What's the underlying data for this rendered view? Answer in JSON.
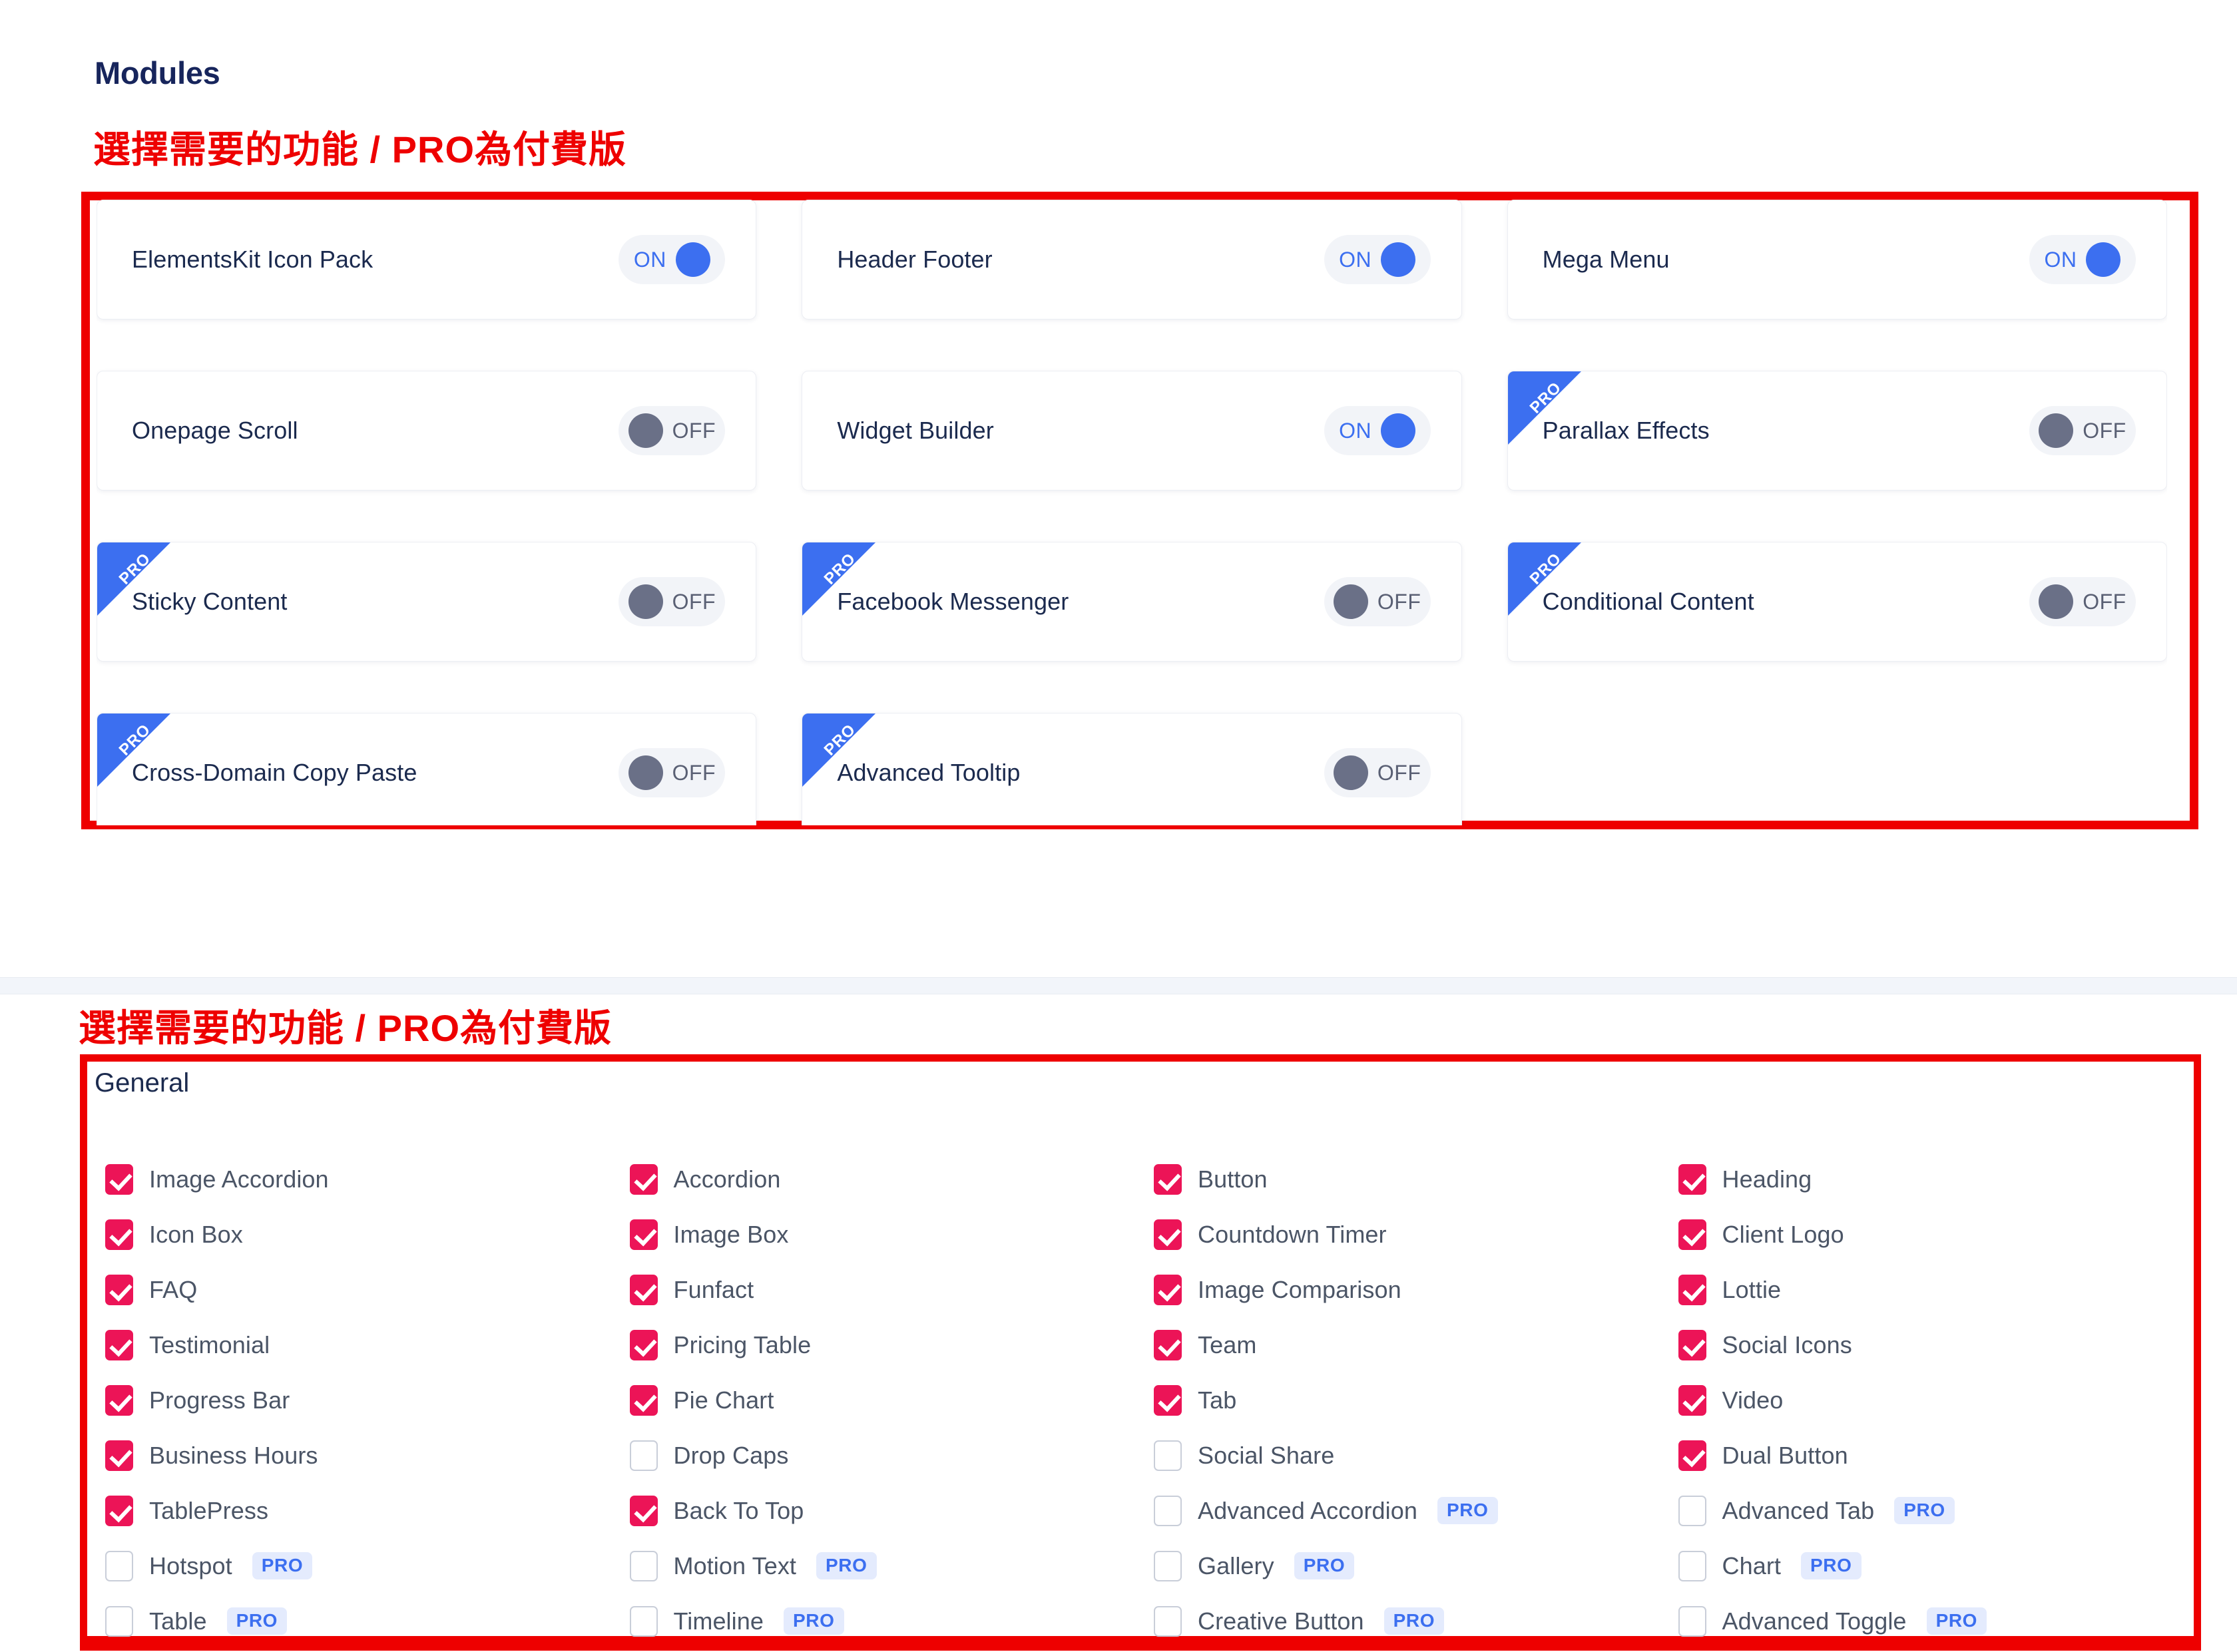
{
  "header": {
    "page_title": "Modules",
    "annotation_modules": "選擇需要的功能 / PRO為付費版",
    "annotation_widgets": "選擇需要的功能 / PRO為付費版"
  },
  "colors": {
    "annotation_red": "#ee0000",
    "toggle_on_blue": "#3c6ff0",
    "toggle_off_gray": "#6a7087",
    "checkbox_checked": "#ec1457",
    "pro_badge_text": "#3c6ff0",
    "pro_badge_bg": "#e4ebfd",
    "title_navy": "#17255c"
  },
  "modules": {
    "toggle_on_label": "ON",
    "toggle_off_label": "OFF",
    "pro_ribbon_label": "PRO",
    "cards": [
      {
        "name": "ElementsKit Icon Pack",
        "state": "ON",
        "pro": false
      },
      {
        "name": "Header Footer",
        "state": "ON",
        "pro": false
      },
      {
        "name": "Mega Menu",
        "state": "ON",
        "pro": false
      },
      {
        "name": "Onepage Scroll",
        "state": "OFF",
        "pro": false
      },
      {
        "name": "Widget Builder",
        "state": "ON",
        "pro": false
      },
      {
        "name": "Parallax Effects",
        "state": "OFF",
        "pro": true
      },
      {
        "name": "Sticky Content",
        "state": "OFF",
        "pro": true
      },
      {
        "name": "Facebook Messenger",
        "state": "OFF",
        "pro": true
      },
      {
        "name": "Conditional Content",
        "state": "OFF",
        "pro": true
      },
      {
        "name": "Cross-Domain Copy Paste",
        "state": "OFF",
        "pro": true
      },
      {
        "name": "Advanced Tooltip",
        "state": "OFF",
        "pro": true
      }
    ]
  },
  "widgets": {
    "group_title": "General",
    "pro_badge_label": "PRO",
    "items": [
      {
        "label": "Image Accordion",
        "checked": true,
        "pro": false
      },
      {
        "label": "Icon Box",
        "checked": true,
        "pro": false
      },
      {
        "label": "FAQ",
        "checked": true,
        "pro": false
      },
      {
        "label": "Testimonial",
        "checked": true,
        "pro": false
      },
      {
        "label": "Progress Bar",
        "checked": true,
        "pro": false
      },
      {
        "label": "Business Hours",
        "checked": true,
        "pro": false
      },
      {
        "label": "TablePress",
        "checked": true,
        "pro": false
      },
      {
        "label": "Hotspot",
        "checked": false,
        "pro": true
      },
      {
        "label": "Table",
        "checked": false,
        "pro": true
      },
      {
        "label": "Accordion",
        "checked": true,
        "pro": false
      },
      {
        "label": "Image Box",
        "checked": true,
        "pro": false
      },
      {
        "label": "Funfact",
        "checked": true,
        "pro": false
      },
      {
        "label": "Pricing Table",
        "checked": true,
        "pro": false
      },
      {
        "label": "Pie Chart",
        "checked": true,
        "pro": false
      },
      {
        "label": "Drop Caps",
        "checked": false,
        "pro": false
      },
      {
        "label": "Back To Top",
        "checked": true,
        "pro": false
      },
      {
        "label": "Motion Text",
        "checked": false,
        "pro": true
      },
      {
        "label": "Timeline",
        "checked": false,
        "pro": true
      },
      {
        "label": "Button",
        "checked": true,
        "pro": false
      },
      {
        "label": "Countdown Timer",
        "checked": true,
        "pro": false
      },
      {
        "label": "Image Comparison",
        "checked": true,
        "pro": false
      },
      {
        "label": "Team",
        "checked": true,
        "pro": false
      },
      {
        "label": "Tab",
        "checked": true,
        "pro": false
      },
      {
        "label": "Social Share",
        "checked": false,
        "pro": false
      },
      {
        "label": "Advanced Accordion",
        "checked": false,
        "pro": true
      },
      {
        "label": "Gallery",
        "checked": false,
        "pro": true
      },
      {
        "label": "Creative Button",
        "checked": false,
        "pro": true
      },
      {
        "label": "Heading",
        "checked": true,
        "pro": false
      },
      {
        "label": "Client Logo",
        "checked": true,
        "pro": false
      },
      {
        "label": "Lottie",
        "checked": true,
        "pro": false
      },
      {
        "label": "Social Icons",
        "checked": true,
        "pro": false
      },
      {
        "label": "Video",
        "checked": true,
        "pro": false
      },
      {
        "label": "Dual Button",
        "checked": true,
        "pro": false
      },
      {
        "label": "Advanced Tab",
        "checked": false,
        "pro": true
      },
      {
        "label": "Chart",
        "checked": false,
        "pro": true
      },
      {
        "label": "Advanced Toggle",
        "checked": false,
        "pro": true
      }
    ]
  }
}
